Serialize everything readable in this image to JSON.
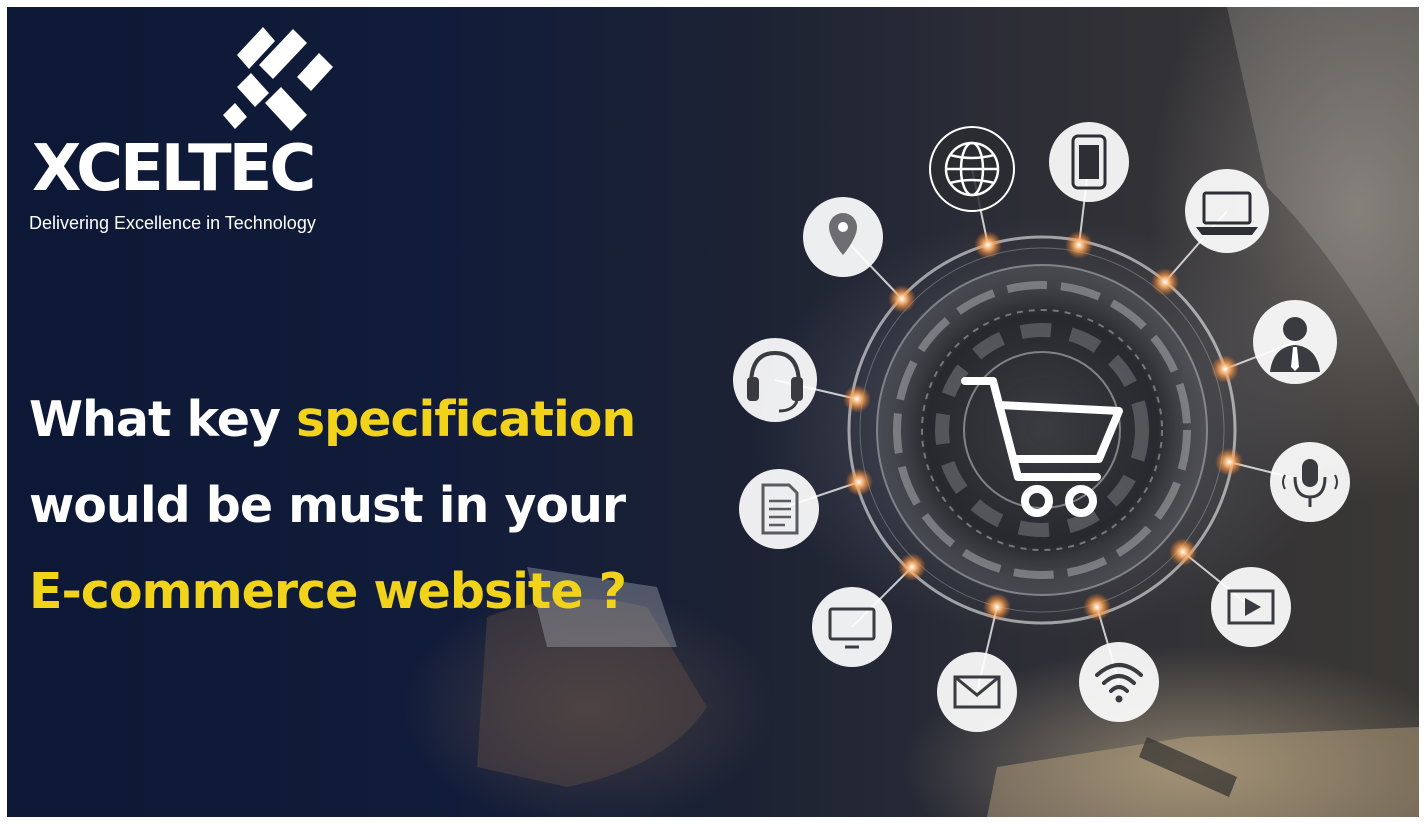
{
  "brand": {
    "name": "XCELTEC",
    "tagline": "Delivering Excellence in Technology"
  },
  "headline": {
    "line1_start": "What key ",
    "line1_highlight": "specification",
    "line2": "would be must in your",
    "line3_highlight": "E-commerce website ?"
  },
  "icons": [
    "location-pin-icon",
    "globe-icon",
    "tablet-icon",
    "laptop-icon",
    "person-icon",
    "headphones-icon",
    "microphone-icon",
    "document-icon",
    "video-icon",
    "monitor-icon",
    "mail-icon",
    "wifi-icon",
    "shopping-cart-icon"
  ],
  "colors": {
    "accent_yellow": "#f2d31b",
    "text_white": "#ffffff",
    "background_navy": "#0c1835",
    "glow_orange": "#ff9a4a"
  }
}
